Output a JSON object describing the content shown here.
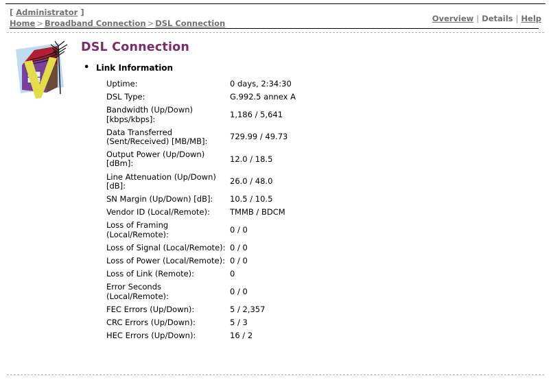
{
  "header": {
    "admin_prefix": "[",
    "admin_label": "Administrator",
    "admin_suffix": "]",
    "breadcrumb": [
      {
        "label": "Home",
        "link": true
      },
      {
        "label": "Broadband Connection",
        "link": true
      },
      {
        "label": "DSL Connection",
        "link": true
      }
    ],
    "breadcrumb_separator": ">",
    "toplinks": [
      {
        "label": "Overview",
        "link": true
      },
      {
        "label": "Details",
        "link": false
      },
      {
        "label": "Help",
        "link": true
      }
    ],
    "toplinks_separator": "|"
  },
  "page": {
    "title": "DSL Connection",
    "title_color": "#7b2d6b",
    "logo_name": "house-antenna-logo"
  },
  "section": {
    "heading": "Link Information",
    "bullet": "•"
  },
  "link_information": {
    "rows": [
      {
        "label": "Uptime:",
        "value": "0 days, 2:34:30"
      },
      {
        "label": "DSL Type:",
        "value": "G.992.5 annex A"
      },
      {
        "label": "Bandwidth (Up/Down) [kbps/kbps]:",
        "value": "1,186 / 5,641"
      },
      {
        "label": "Data Transferred (Sent/Received) [MB/MB]:",
        "value": "729.99 / 49.73"
      },
      {
        "label": "Output Power (Up/Down) [dBm]:",
        "value": "12.0 / 18.5"
      },
      {
        "label": "Line Attenuation (Up/Down) [dB]:",
        "value": "26.0 / 48.0"
      },
      {
        "label": "SN Margin (Up/Down) [dB]:",
        "value": "10.5 / 10.5"
      },
      {
        "label": "Vendor ID (Local/Remote):",
        "value": "TMMB / BDCM"
      },
      {
        "label": "Loss of Framing (Local/Remote):",
        "value": "0 / 0"
      },
      {
        "label": "Loss of Signal (Local/Remote):",
        "value": "0 / 0"
      },
      {
        "label": "Loss of Power (Local/Remote):",
        "value": "0 / 0"
      },
      {
        "label": "Loss of Link (Remote):",
        "value": "0"
      },
      {
        "label": "Error Seconds (Local/Remote):",
        "value": "0 / 0"
      },
      {
        "label": "FEC Errors (Up/Down):",
        "value": "5 / 2,357"
      },
      {
        "label": "CRC Errors (Up/Down):",
        "value": "5 / 3"
      },
      {
        "label": "HEC Errors (Up/Down):",
        "value": "16 / 2"
      }
    ]
  }
}
